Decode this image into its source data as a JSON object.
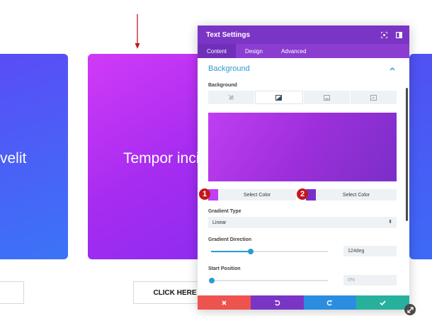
{
  "page": {
    "card_left_text": "velit",
    "card_mid_text": "Tempor incidi",
    "button_text": "CLICK HERE"
  },
  "panel": {
    "title": "Text Settings",
    "tabs": [
      {
        "label": "Content",
        "active": true
      },
      {
        "label": "Design",
        "active": false
      },
      {
        "label": "Advanced",
        "active": false
      }
    ],
    "section_title": "Background",
    "background_label": "Background",
    "background_types": [
      "color-icon",
      "gradient-icon",
      "image-icon",
      "video-icon"
    ],
    "color_stops": [
      {
        "badge": "1",
        "label": "Select Color",
        "color": "#c13ef3"
      },
      {
        "badge": "2",
        "label": "Select Color",
        "color": "#7a2fc8"
      }
    ],
    "gradient_type_label": "Gradient Type",
    "gradient_type_value": "Linear",
    "gradient_direction_label": "Gradient Direction",
    "gradient_direction_value": "124deg",
    "gradient_direction_fraction": 0.34,
    "start_position_label": "Start Position",
    "start_position_value": "0%",
    "start_position_fraction": 0.0
  },
  "footer": {
    "buttons": [
      "close-icon",
      "undo-icon",
      "redo-icon",
      "check-icon"
    ],
    "colors": [
      "#ef5350",
      "#7b35c4",
      "#2a8de0",
      "#27b19d"
    ]
  },
  "colors": {
    "accent": "#2c9ad4",
    "header": "#7b35c4",
    "badge": "#c4161c"
  }
}
